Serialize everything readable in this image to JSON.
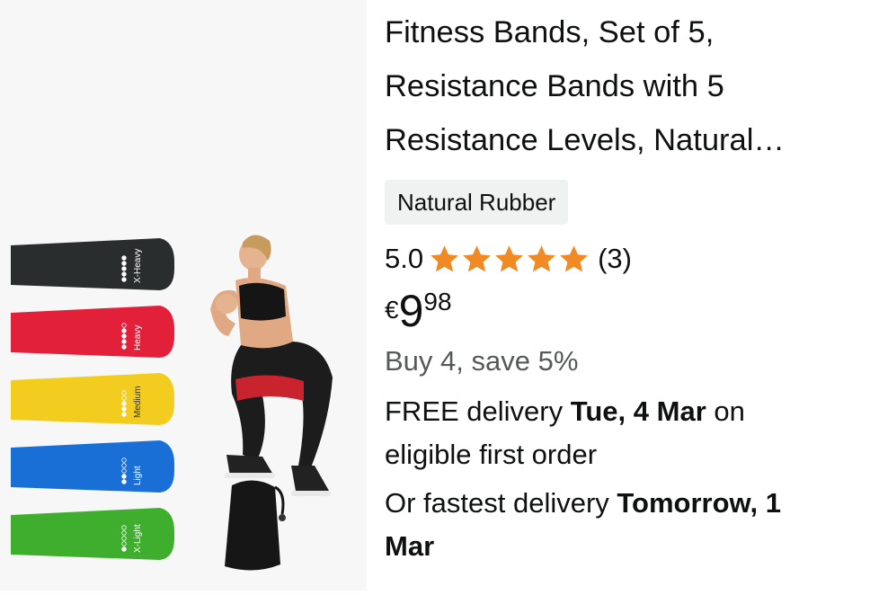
{
  "product": {
    "title_lines": [
      "Fitness Bands, Set of 5,",
      "Resistance Bands with 5",
      "Resistance Levels, Natural…"
    ],
    "variant_chip": "Natural Rubber",
    "rating": {
      "value": "5.0",
      "stars": 5,
      "count": "(3)"
    },
    "price": {
      "currency": "€",
      "whole": "9",
      "fraction": "98"
    },
    "promo": "Buy 4, save 5%",
    "delivery": {
      "prefix": "FREE delivery ",
      "date": "Tue, 4 Mar",
      "suffix_1": " on",
      "suffix_2": "eligible first order"
    },
    "fastest": {
      "prefix": "Or fastest delivery ",
      "date_1": "Tomorrow, 1",
      "date_2": "Mar"
    }
  },
  "image": {
    "bands": [
      {
        "label": "X-Heavy",
        "color": "#2a2d2e",
        "dots": 5
      },
      {
        "label": "Heavy",
        "color": "#e3203a",
        "dots": 4
      },
      {
        "label": "Medium",
        "color": "#f2cd1f",
        "dots": 3
      },
      {
        "label": "Light",
        "color": "#1a6fd6",
        "dots": 2
      },
      {
        "label": "X-Light",
        "color": "#3fae2f",
        "dots": 1
      }
    ]
  },
  "colors": {
    "star": "#f08a24",
    "text": "#0f1111",
    "muted": "#565959",
    "chip_bg": "#f0f2f2"
  }
}
